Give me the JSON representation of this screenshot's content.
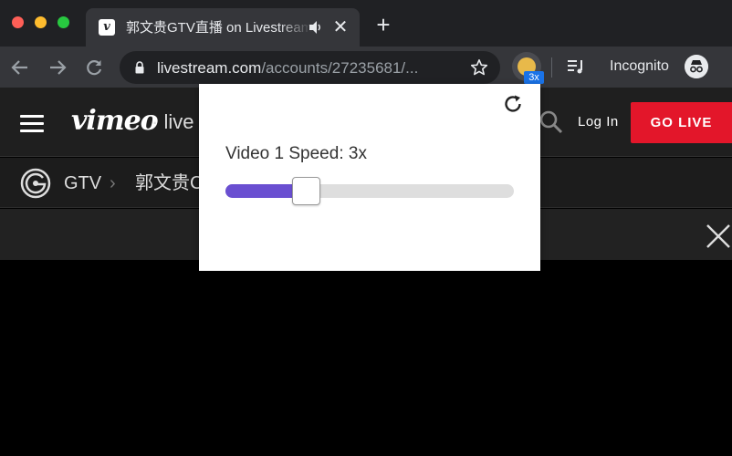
{
  "browser": {
    "tab_title": "郭文贵GTV直播 on Livestream",
    "tab_favicon": "v",
    "tab_close_glyph": "✕",
    "new_tab_glyph": "+",
    "url_host": "livestream.com",
    "url_path": "/accounts/27235681/...",
    "extension_badge": "3x",
    "incognito_label": "Incognito",
    "icons": [
      "back-arrow-icon",
      "forward-arrow-icon",
      "reload-icon",
      "lock-icon",
      "star-icon",
      "reading-list-icon",
      "incognito-icon",
      "audio-icon"
    ]
  },
  "site": {
    "logo": "vimeo",
    "logo_suffix": "· live",
    "login": "Log In",
    "go_live": "GO LIVE",
    "breadcrumb": {
      "account": "GTV",
      "separator": "›",
      "title": "郭文贵C"
    },
    "brand_color": "#e3162a"
  },
  "popup": {
    "label": "Video 1 Speed:",
    "value": "3x",
    "slider": {
      "fraction": 0.28,
      "accent": "#6a4fd1"
    }
  }
}
